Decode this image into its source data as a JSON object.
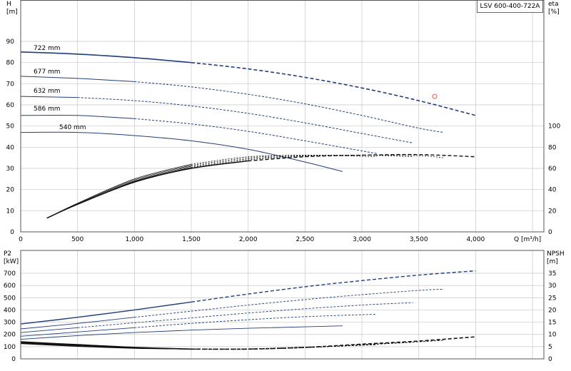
{
  "model_label": "LSV 600-400-722A",
  "colors": {
    "curve": "#1f3f7a",
    "eta": "#111111",
    "grid": "#c8c8c8",
    "duty_point": "#e06060"
  },
  "chart_data": [
    {
      "type": "line",
      "name": "head-and-efficiency",
      "xlabel": "Q [m³/h]",
      "ylabel": "H\n[m]",
      "y2label": "eta\n[%]",
      "xlim": [
        0,
        4600
      ],
      "ylim": [
        0,
        100
      ],
      "y2lim": [
        0,
        160
      ],
      "x_ticks": [
        0,
        500,
        1000,
        1500,
        2000,
        2500,
        3000,
        3500,
        4000
      ],
      "x_tick_labels": [
        "0",
        "500",
        "1,000",
        "1,500",
        "2,000",
        "2,500",
        "3,000",
        "3,500",
        "4,000"
      ],
      "y_ticks": [
        0,
        10,
        20,
        30,
        40,
        50,
        60,
        70,
        80,
        90
      ],
      "y2_ticks": [
        0,
        20,
        40,
        60,
        80,
        100
      ],
      "grid": true,
      "series": [
        {
          "name": "722 mm",
          "x": [
            0,
            500,
            1000,
            1500,
            2000,
            2500,
            3000,
            3500,
            4000
          ],
          "y": [
            85,
            84,
            82.3,
            80,
            77,
            73,
            68,
            62,
            55
          ]
        },
        {
          "name": "677 mm",
          "x": [
            0,
            500,
            1000,
            1500,
            2000,
            2500,
            3000,
            3500,
            3720
          ],
          "y": [
            73.5,
            72.5,
            71,
            68.5,
            65,
            60.5,
            55,
            49,
            47
          ]
        },
        {
          "name": "632 mm",
          "x": [
            0,
            500,
            1000,
            1500,
            2000,
            2500,
            3000,
            3450
          ],
          "y": [
            64,
            63.5,
            62,
            59.5,
            56,
            51.5,
            46.5,
            42
          ]
        },
        {
          "name": "586 mm",
          "x": [
            0,
            500,
            1000,
            1500,
            2000,
            2500,
            3130
          ],
          "y": [
            55,
            55,
            53.5,
            51,
            47.5,
            43,
            37
          ]
        },
        {
          "name": "540 mm",
          "x": [
            0,
            500,
            1000,
            1500,
            2000,
            2500,
            2830
          ],
          "y": [
            47,
            47,
            45.5,
            43,
            39,
            33,
            28.5
          ]
        }
      ],
      "efficiency_series": [
        {
          "x": [
            230,
            500,
            1000,
            1500,
            2000,
            2500,
            3000,
            3500,
            4000
          ],
          "y": [
            13,
            26,
            47,
            60,
            67,
            71,
            72.5,
            73,
            71
          ]
        },
        {
          "x": [
            230,
            500,
            1000,
            1500,
            2000,
            2500,
            3000,
            3500,
            3720
          ],
          "y": [
            13,
            26,
            47.5,
            61,
            68,
            71.5,
            72.5,
            72,
            70
          ]
        },
        {
          "x": [
            230,
            500,
            1000,
            1500,
            2000,
            2500,
            3000,
            3450
          ],
          "y": [
            13,
            26,
            48,
            62,
            69,
            72,
            72.5,
            71
          ]
        },
        {
          "x": [
            230,
            500,
            1000,
            1500,
            2000,
            2500,
            3130
          ],
          "y": [
            13,
            26.5,
            49,
            63,
            70,
            72.5,
            71
          ]
        },
        {
          "x": [
            230,
            500,
            1000,
            1500,
            2000,
            2500,
            2830
          ],
          "y": [
            13,
            27,
            50,
            64,
            71,
            72.5,
            72
          ]
        }
      ],
      "curve_labels": [
        "722 mm",
        "677 mm",
        "632 mm",
        "586 mm",
        "540 mm"
      ],
      "duty_point": {
        "x": 3640,
        "y": 64
      }
    },
    {
      "type": "line",
      "name": "power-and-npsh",
      "xlabel": "",
      "ylabel": "P2\n[kW]",
      "y2label": "NPSH\n[m]",
      "xlim": [
        0,
        4600
      ],
      "ylim": [
        0,
        800
      ],
      "y2lim": [
        0,
        40
      ],
      "y_ticks": [
        0,
        100,
        200,
        300,
        400,
        500,
        600,
        700
      ],
      "y2_ticks": [
        0,
        5,
        10,
        15,
        20,
        25,
        30,
        35
      ],
      "grid": true,
      "series": [
        {
          "name": "722 mm",
          "x": [
            0,
            500,
            1000,
            1500,
            2000,
            2500,
            3000,
            3500,
            4000
          ],
          "y": [
            285,
            340,
            400,
            465,
            530,
            590,
            640,
            685,
            720
          ]
        },
        {
          "name": "677 mm",
          "x": [
            0,
            500,
            1000,
            1500,
            2000,
            2500,
            3000,
            3500,
            3720
          ],
          "y": [
            245,
            290,
            340,
            390,
            440,
            485,
            525,
            560,
            570
          ]
        },
        {
          "name": "632 mm",
          "x": [
            0,
            500,
            1000,
            1500,
            2000,
            2500,
            3000,
            3450
          ],
          "y": [
            215,
            255,
            295,
            335,
            375,
            410,
            440,
            460
          ]
        },
        {
          "name": "586 mm",
          "x": [
            0,
            500,
            1000,
            1500,
            2000,
            2500,
            3130
          ],
          "y": [
            185,
            220,
            255,
            290,
            320,
            345,
            365
          ]
        },
        {
          "name": "540 mm",
          "x": [
            0,
            500,
            1000,
            1500,
            2000,
            2500,
            2830
          ],
          "y": [
            160,
            190,
            215,
            235,
            250,
            262,
            270
          ]
        }
      ],
      "npsh_series": [
        {
          "x": [
            0,
            500,
            1000,
            1500,
            2000,
            2500,
            3000,
            3500,
            4000
          ],
          "y": [
            7,
            5.8,
            4.7,
            4,
            4,
            4.7,
            6,
            7.3,
            9
          ]
        },
        {
          "x": [
            0,
            500,
            1000,
            1500,
            2000,
            2500,
            3000,
            3500,
            3720
          ],
          "y": [
            6.8,
            5.6,
            4.6,
            4,
            4,
            4.6,
            5.8,
            7,
            7.6
          ]
        },
        {
          "x": [
            0,
            500,
            1000,
            1500,
            2000,
            2500,
            3000,
            3450
          ],
          "y": [
            6.6,
            5.5,
            4.5,
            4,
            4,
            4.6,
            5.7,
            6.8
          ]
        },
        {
          "x": [
            0,
            500,
            1000,
            1500,
            2000,
            2500,
            3130
          ],
          "y": [
            6.4,
            5.3,
            4.4,
            4,
            4,
            4.7,
            5.8
          ]
        },
        {
          "x": [
            0,
            500,
            1000,
            1500,
            2000,
            2500,
            2830
          ],
          "y": [
            6.2,
            5.1,
            4.3,
            4,
            4.1,
            4.8,
            5.2
          ]
        }
      ]
    }
  ]
}
